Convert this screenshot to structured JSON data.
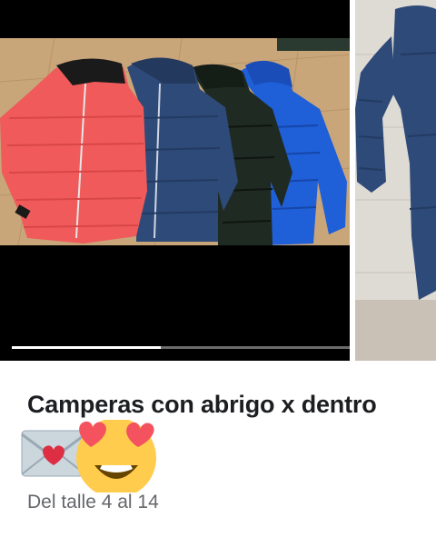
{
  "post": {
    "title": "Camperas con abrigo x dentro",
    "subtitle": "Del talle 4 al 14"
  },
  "carousel": {
    "progress": 0.44,
    "main_image_alt": "Camperas rellenas en colores rojo, azul marino, verde oscuro y azul",
    "next_image_alt": "Campera azul marino colgada"
  },
  "emoji": [
    "love-letter-icon",
    "heart-eyes-icon"
  ],
  "colors": {
    "jacket_red": "#f05a5a",
    "jacket_navy": "#2e4a78",
    "jacket_green": "#1f2b22",
    "jacket_blue": "#1f5fd8",
    "text_primary": "#1c1e21",
    "text_secondary": "#65676b"
  }
}
